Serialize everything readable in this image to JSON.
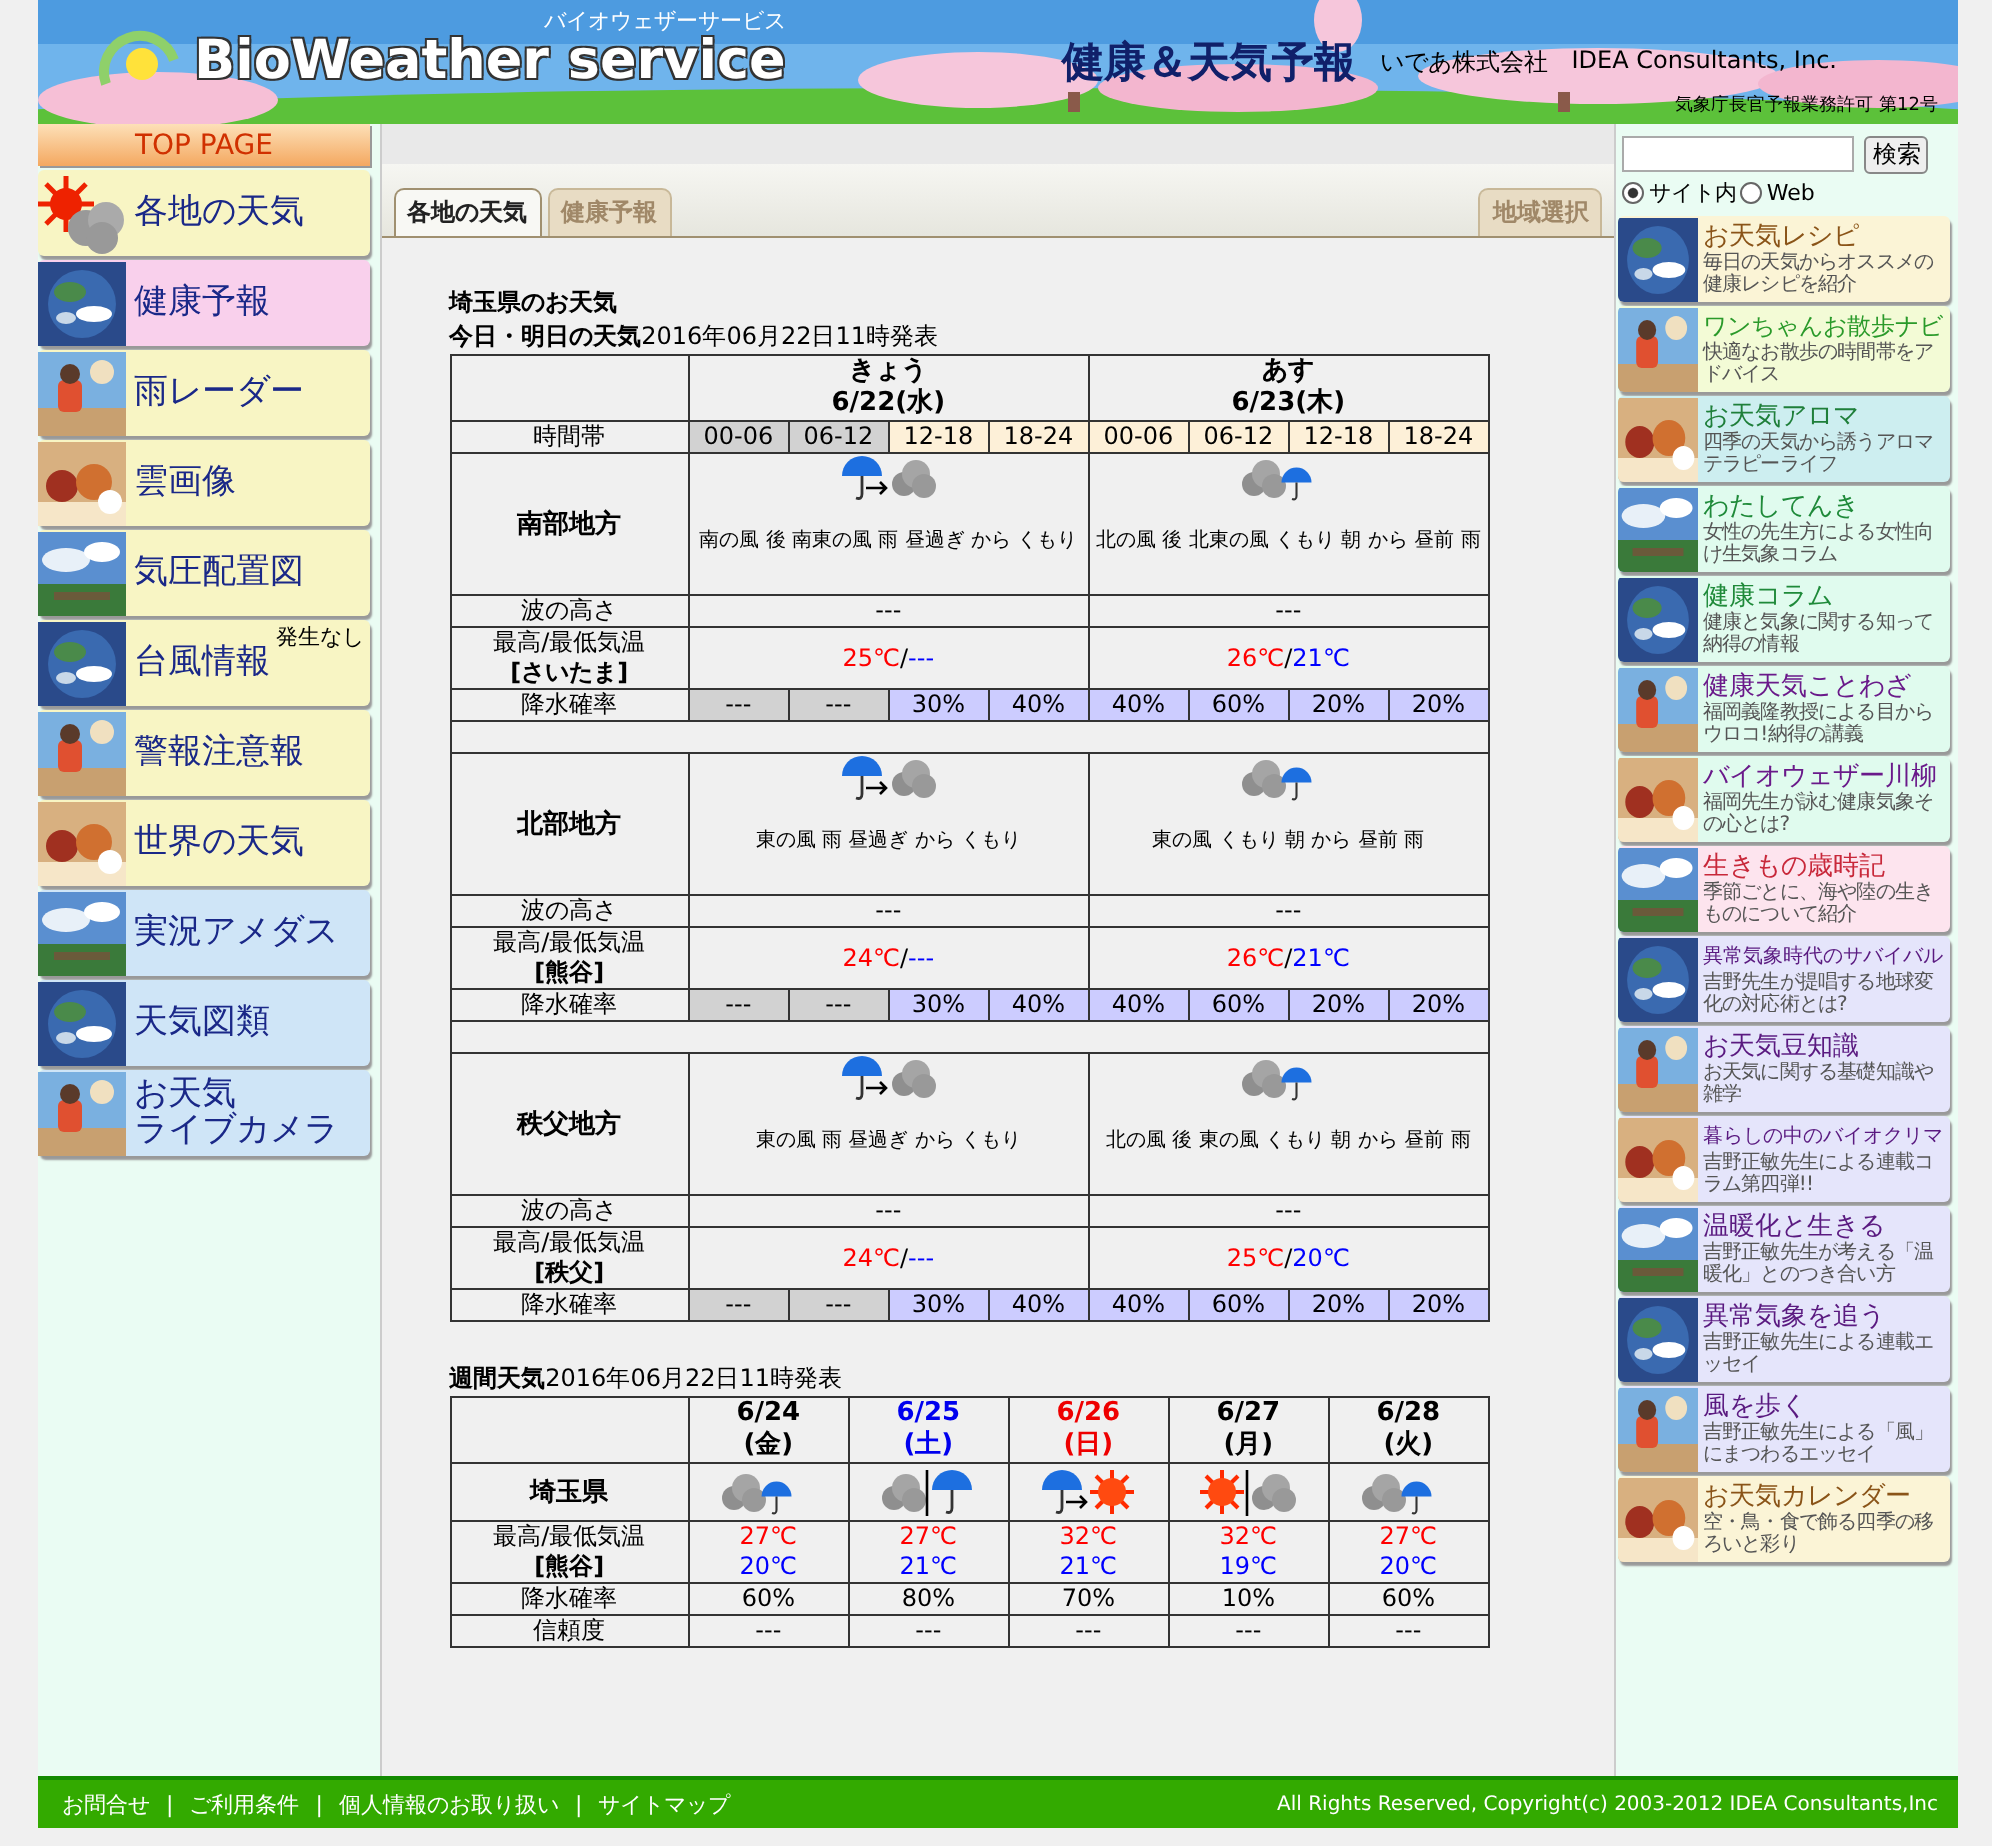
{
  "header": {
    "logo_kana": "バイオウェザーサービス",
    "logo": "BioWeather service",
    "title": "健康＆天気予報",
    "company_jp": "いであ株式会社",
    "company_en": "IDEA Consultants, Inc.",
    "license": "気象庁長官予報業務許可 第12号"
  },
  "left_nav": {
    "top_page": "TOP PAGE",
    "items": [
      {
        "lines": [
          "各地の天気"
        ],
        "color": "#f8f5c4",
        "kind": "icon"
      },
      {
        "lines": [
          "健康予報"
        ],
        "color": "#f9d0ec",
        "kind": "picture"
      },
      {
        "lines": [
          "雨レーダー"
        ],
        "color": "#f8f5c4",
        "kind": "picture"
      },
      {
        "lines": [
          "雲画像"
        ],
        "color": "#f8f5c4",
        "kind": "picture"
      },
      {
        "lines": [
          "気圧配置図"
        ],
        "color": "#f8f5c4",
        "kind": "picture"
      },
      {
        "lines": [
          "台風情報"
        ],
        "color": "#f8f5c4",
        "kind": "picture",
        "badge": "発生なし"
      },
      {
        "lines": [
          "警報注意報"
        ],
        "color": "#f8f5c4",
        "kind": "picture"
      },
      {
        "lines": [
          "世界の天気"
        ],
        "color": "#f8f5c4",
        "kind": "picture"
      },
      {
        "lines": [
          "実況アメダス"
        ],
        "color": "#cfe5f7",
        "kind": "picture"
      },
      {
        "lines": [
          "天気図類"
        ],
        "color": "#cfe5f7",
        "kind": "picture"
      },
      {
        "lines": [
          "お天気",
          "ライブカメラ"
        ],
        "color": "#cfe5f7",
        "kind": "picture"
      }
    ]
  },
  "tabs": [
    {
      "label": "各地の天気",
      "selected": true
    },
    {
      "label": "健康予報",
      "selected": false
    }
  ],
  "region_button": "地域選択",
  "search": {
    "button": "検索",
    "scopes": [
      {
        "label": "サイト内",
        "selected": true
      },
      {
        "label": "Web",
        "selected": false
      }
    ]
  },
  "heading": "埼玉県のお天気",
  "forecast": {
    "title": "**今日・明日の天気**2016年06月22日11時発表",
    "days": [
      {
        "label": "きょう",
        "date": "6/22(水)"
      },
      {
        "label": "あす",
        "date": "6/23(木)"
      }
    ],
    "time_label": "時間帯",
    "time_slots": [
      {
        "label": "00-06",
        "past": true
      },
      {
        "label": "06-12",
        "past": true
      },
      {
        "label": "12-18",
        "past": false
      },
      {
        "label": "18-24",
        "past": false
      },
      {
        "label": "00-06",
        "past": false
      },
      {
        "label": "06-12",
        "past": false
      },
      {
        "label": "12-18",
        "past": false
      },
      {
        "label": "18-24",
        "past": false
      }
    ],
    "temp_separator": "/",
    "regions": [
      {
        "name": "南部地方",
        "weather": [
          {
            "icon": {
              "kind": "rain-then-cloudy"
            },
            "text": "南の風 後 南東の風 雨 昼過ぎ から くもり"
          },
          {
            "icon": {
              "kind": "cloudy-chance-rain"
            },
            "text": "北の風 後 北東の風 くもり 朝 から 昼前 雨"
          }
        ],
        "wave_label": "波の高さ",
        "waves": [
          "---",
          "---"
        ],
        "temp_label": "最高/最低気温",
        "station": "[さいたま]",
        "temps": [
          {
            "high": "25℃",
            "low": "---"
          },
          {
            "high": "26℃",
            "low": "21℃"
          }
        ],
        "pop_label": "降水確率",
        "pops": [
          {
            "value": "---",
            "past": true
          },
          {
            "value": "---",
            "past": true
          },
          {
            "value": "30%",
            "past": false
          },
          {
            "value": "40%",
            "past": false
          },
          {
            "value": "40%",
            "past": false
          },
          {
            "value": "60%",
            "past": false
          },
          {
            "value": "20%",
            "past": false
          },
          {
            "value": "20%",
            "past": false
          }
        ]
      },
      {
        "name": "北部地方",
        "weather": [
          {
            "icon": {
              "kind": "rain-then-cloudy"
            },
            "text": "東の風 雨 昼過ぎ から くもり"
          },
          {
            "icon": {
              "kind": "cloudy-chance-rain"
            },
            "text": "東の風 くもり 朝 から 昼前 雨"
          }
        ],
        "wave_label": "波の高さ",
        "waves": [
          "---",
          "---"
        ],
        "temp_label": "最高/最低気温",
        "station": "[熊谷]",
        "temps": [
          {
            "high": "24℃",
            "low": "---"
          },
          {
            "high": "26℃",
            "low": "21℃"
          }
        ],
        "pop_label": "降水確率",
        "pops": [
          {
            "value": "---",
            "past": true
          },
          {
            "value": "---",
            "past": true
          },
          {
            "value": "30%",
            "past": false
          },
          {
            "value": "40%",
            "past": false
          },
          {
            "value": "40%",
            "past": false
          },
          {
            "value": "60%",
            "past": false
          },
          {
            "value": "20%",
            "past": false
          },
          {
            "value": "20%",
            "past": false
          }
        ]
      },
      {
        "name": "秩父地方",
        "weather": [
          {
            "icon": {
              "kind": "rain-then-cloudy"
            },
            "text": "東の風 雨 昼過ぎ から くもり"
          },
          {
            "icon": {
              "kind": "cloudy-chance-rain"
            },
            "text": "北の風 後 東の風 くもり 朝 から 昼前 雨"
          }
        ],
        "wave_label": "波の高さ",
        "waves": [
          "---",
          "---"
        ],
        "temp_label": "最高/最低気温",
        "station": "[秩父]",
        "temps": [
          {
            "high": "24℃",
            "low": "---"
          },
          {
            "high": "25℃",
            "low": "20℃"
          }
        ],
        "pop_label": "降水確率",
        "pops": [
          {
            "value": "---",
            "past": true
          },
          {
            "value": "---",
            "past": true
          },
          {
            "value": "30%",
            "past": false
          },
          {
            "value": "40%",
            "past": false
          },
          {
            "value": "40%",
            "past": false
          },
          {
            "value": "60%",
            "past": false
          },
          {
            "value": "20%",
            "past": false
          },
          {
            "value": "20%",
            "past": false
          }
        ]
      }
    ]
  },
  "weekly": {
    "title": "**週間天気**2016年06月22日11時発表",
    "region": "埼玉県",
    "temp_label": "最高/最低気温",
    "station": "[熊谷]",
    "pop_label": "降水確率",
    "reliability_label": "信頼度",
    "days": [
      {
        "date": "6/24",
        "weekday": "(金)",
        "kind": "weekday",
        "icon": {
          "kind": "cloudy-chance-rain"
        },
        "high": "27℃",
        "low": "20℃",
        "pop": "60%",
        "reliability": "---"
      },
      {
        "date": "6/25",
        "weekday": "(土)",
        "kind": "saturday",
        "icon": {
          "kind": "cloudy-or-rain"
        },
        "high": "27℃",
        "low": "21℃",
        "pop": "80%",
        "reliability": "---"
      },
      {
        "date": "6/26",
        "weekday": "(日)",
        "kind": "sunday",
        "icon": {
          "kind": "rain-then-sunny"
        },
        "high": "32℃",
        "low": "21℃",
        "pop": "70%",
        "reliability": "---"
      },
      {
        "date": "6/27",
        "weekday": "(月)",
        "kind": "weekday",
        "icon": {
          "kind": "sunny-or-cloudy"
        },
        "high": "32℃",
        "low": "19℃",
        "pop": "10%",
        "reliability": "---"
      },
      {
        "date": "6/28",
        "weekday": "(火)",
        "kind": "weekday",
        "icon": {
          "kind": "cloudy-chance-rain"
        },
        "high": "27℃",
        "low": "20℃",
        "pop": "60%",
        "reliability": "---"
      }
    ]
  },
  "right_links": [
    {
      "title": "お天気レシピ",
      "description": "毎日の天気からオススメの健康レシピを紹介",
      "kind": "warm"
    },
    {
      "title": "ワンちゃんお散歩ナビ",
      "description": "快適なお散歩の時間帯をアドバイス",
      "kind": "fresh"
    },
    {
      "title": "お天気アロマ",
      "description": "四季の天気から誘うアロマテラピーライフ",
      "kind": "sky"
    },
    {
      "title": "わたしてんき",
      "description": "女性の先生方による女性向け生気象コラム",
      "kind": "mint"
    },
    {
      "title": "健康コラム",
      "description": "健康と気象に関する知って納得の情報",
      "kind": "mint"
    },
    {
      "title": "健康天気ことわざ",
      "description": "福岡義隆教授による目からウロコ!納得の講義",
      "kind": "mintp"
    },
    {
      "title": "バイオウェザー川柳",
      "description": "福岡先生が詠む健康気象その心とは?",
      "kind": "mintp"
    },
    {
      "title": "生きもの歳時記",
      "description": "季節ごとに、海や陸の生きものについて紹介",
      "kind": "blossom"
    },
    {
      "title": "異常気象時代のサバイバル",
      "description": "吉野先生が提唱する地球変化の対応術とは?",
      "kind": "lavender"
    },
    {
      "title": "お天気豆知識",
      "description": "お天気に関する基礎知識や雑学",
      "kind": "lavender"
    },
    {
      "title": "暮らしの中のバイオクリマ",
      "description": "吉野正敏先生による連載コラム第四弾!!",
      "kind": "lavender"
    },
    {
      "title": "温暖化と生きる",
      "description": "吉野正敏先生が考える「温暖化」とのつき合い方",
      "kind": "lavender"
    },
    {
      "title": "異常気象を追う",
      "description": "吉野正敏先生による連載エッセイ",
      "kind": "lavender"
    },
    {
      "title": "風を歩く",
      "description": "吉野正敏先生による「風」にまつわるエッセイ",
      "kind": "lavender"
    },
    {
      "title": "お天気カレンダー",
      "description": "空・鳥・食で飾る四季の移ろいと彩り",
      "kind": "warm"
    }
  ],
  "footer": {
    "links": [
      "お問合せ",
      "ご利用条件",
      "個人情報のお取り扱い",
      "サイトマップ"
    ],
    "separator": "|",
    "copyright": "All Rights Reserved, Copyright(c) 2003-2012 IDEA Consultants,Inc"
  }
}
